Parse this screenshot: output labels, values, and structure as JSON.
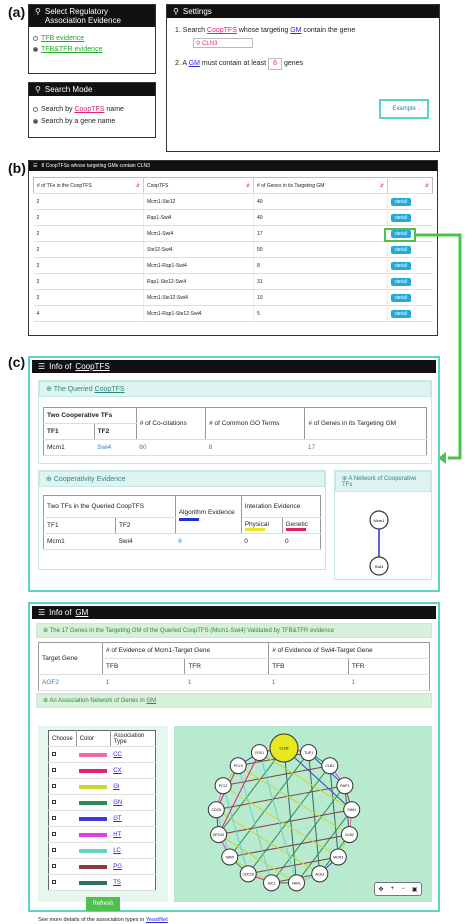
{
  "labels": {
    "a": "(a)",
    "b": "(b)",
    "c": "(c)"
  },
  "evidence": {
    "title": "Select Regulatory Association Evidence",
    "opt1": "TFB evidence",
    "opt2": "TFB&TFR evidence"
  },
  "settings": {
    "title": "Settings",
    "line1_pre": "1. Search",
    "line1_link": "CoopTFS",
    "line1_mid": "whose targeting",
    "line1_link2": "GM",
    "line1_post": "contain the gene",
    "gene": "CLN3",
    "line2_pre": "2. A",
    "line2_link": "GM",
    "line2_mid": "must contain at least",
    "min_genes": "6",
    "line2_post": "genes",
    "example_btn": "Example"
  },
  "search_mode": {
    "title": "Search Mode",
    "opt1_pre": "Search by",
    "opt1_link": "CoopTFS",
    "opt1_post": "name",
    "opt2": "Search by a gene name"
  },
  "results": {
    "title": "8 CoopTFSs whose targeting GMs contain CLN3",
    "headers": [
      "# of TFs in the CoopTFS",
      "CoopTFS",
      "# of Genes in its Targeting GM",
      ""
    ],
    "detail_label": "detail",
    "rows": [
      [
        "2",
        "Mcm1-Ste12",
        "40"
      ],
      [
        "2",
        "Rap1-Swi4",
        "40"
      ],
      [
        "2",
        "Mcm1-Swi4",
        "17"
      ],
      [
        "2",
        "Ste12-Swi4",
        "50"
      ],
      [
        "3",
        "Mcm1-Rap1-Swi4",
        "8"
      ],
      [
        "3",
        "Rap1-Ste12-Swi4",
        "31"
      ],
      [
        "3",
        "Mcm1-Ste12-Swi4",
        "10"
      ],
      [
        "4",
        "Mcm1-Rap1-Ste12-Swi4",
        "5"
      ]
    ]
  },
  "coop": {
    "title_pre": "Info of",
    "title_link": "CoopTFS",
    "queried_pre": "The Queried",
    "queried_link": "CoopTFS",
    "th_two": "Two Cooperative TFs",
    "th_tf1": "TF1",
    "th_tf2": "TF2",
    "th_cocit": "# of Co-citations",
    "th_go": "# of Common GO Terms",
    "th_genes": "# of Genes in its Targeting GM",
    "row": [
      "Mcm1",
      "Swi4",
      "60",
      "8",
      "17"
    ],
    "evidence_title": "Cooperativity Evidence",
    "network_title": "A Network of Cooperative TFs",
    "ev_th_two": "Two TFs in the Queried CoopTFS",
    "ev_th_tf1": "TF1",
    "ev_th_tf2": "TF2",
    "ev_th_algo": "Algorithm Evidence",
    "ev_th_inter": "Interation Evidence",
    "ev_th_phys": "Physical",
    "ev_th_gen": "Genetic",
    "ev_row": [
      "Mcm1",
      "Swi4",
      "6",
      "0",
      "0"
    ],
    "net_nodes": [
      "Mcm1",
      "Swi4"
    ]
  },
  "gm": {
    "title_pre": "Info of",
    "title_link": "GM",
    "banner": "The 17 Genes in the Targeting GM of the Queried CoopTFS (Mcm1-Swi4) Validated by TFB&TFR evidence",
    "th_target": "Target Gene",
    "th_mcm": "# of Evidence of Mcm1-Target Gene",
    "th_swi": "# of Evidence of Swi4-Target Gene",
    "th_tfb": "TFB",
    "th_tfr": "TFR",
    "rows": [
      [
        "AGF2",
        "1",
        "1",
        "1",
        "1"
      ],
      [
        "AGA1",
        "4",
        "4",
        "4",
        "4"
      ]
    ],
    "assoc_title_pre": "An Association Network of Genes in",
    "assoc_title_link": "GM",
    "legend_headers": [
      "Choose",
      "Color",
      "Association Type"
    ],
    "legend": [
      {
        "type": "CC",
        "color": "#f06aa8"
      },
      {
        "type": "CX",
        "color": "#e0207a"
      },
      {
        "type": "GI",
        "color": "#c8d82a"
      },
      {
        "type": "GN",
        "color": "#2e8b57"
      },
      {
        "type": "GT",
        "color": "#3a3adf"
      },
      {
        "type": "HT",
        "color": "#e040e0"
      },
      {
        "type": "LC",
        "color": "#6ad2c8"
      },
      {
        "type": "PG",
        "color": "#8b3a3a"
      },
      {
        "type": "TS",
        "color": "#2f6f5f"
      }
    ],
    "refresh": "Refresh",
    "more_pre": "See more details of the association types in",
    "more_link": "YeastNet",
    "genes": [
      "CLN3",
      "TUP1",
      "CLB1",
      "RAP1",
      "SWI4",
      "CLB2",
      "MCM1",
      "ACE2",
      "FAR1",
      "SIC1",
      "CDC20",
      "SWI5",
      "SPO12",
      "CDC5",
      "PCL2",
      "PCL9",
      "YOX1"
    ]
  }
}
